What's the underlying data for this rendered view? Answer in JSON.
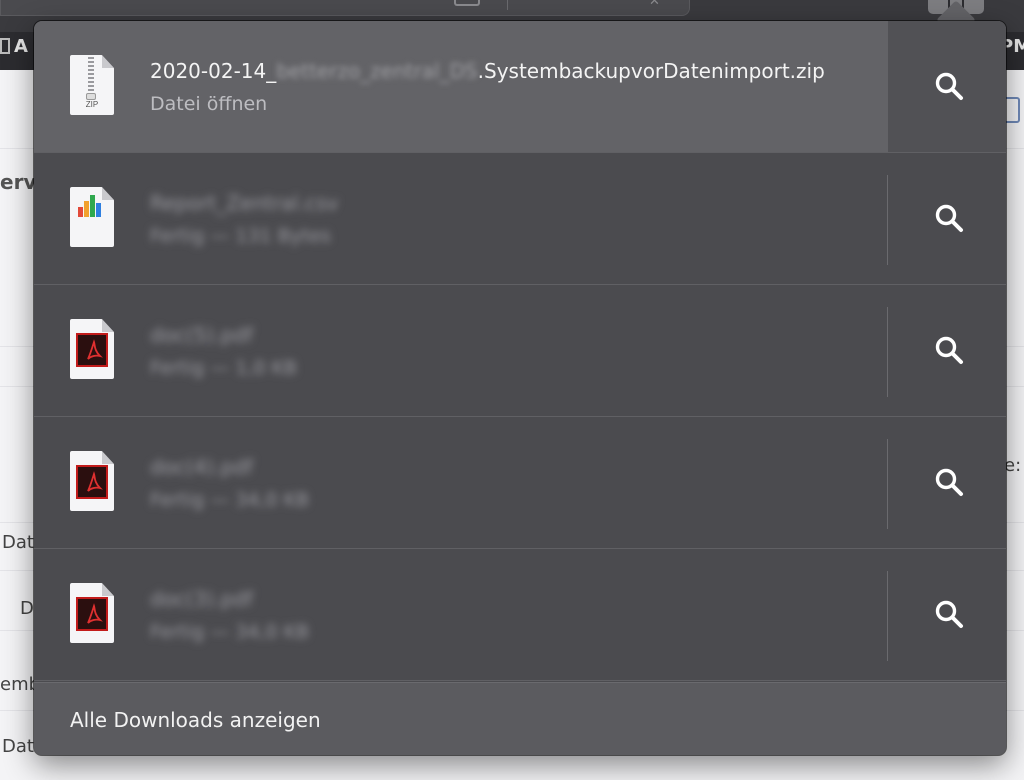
{
  "background": {
    "bookmark_left": "A",
    "bookmark_right": "PM",
    "side_texts": [
      "erv",
      "Dat",
      "D",
      "emb",
      "Dat",
      "e:"
    ]
  },
  "downloads": [
    {
      "type": "zip",
      "icon": "zip-file-icon",
      "name_prefix": "2020-02-14_",
      "name_hidden": "betterzo_zentral_DS",
      "name_suffix": ".SystembackupvorDatenimport.zip",
      "subtitle": "Datei öffnen",
      "selected": true
    },
    {
      "type": "numbers",
      "icon": "numbers-file-icon",
      "name": "Report_Zentral.csv",
      "subtitle": "Fertig — 131 Bytes",
      "selected": false
    },
    {
      "type": "pdf",
      "icon": "pdf-file-icon",
      "name": "doc(5).pdf",
      "subtitle": "Fertig — 1,0 KB",
      "selected": false
    },
    {
      "type": "pdf",
      "icon": "pdf-file-icon",
      "name": "doc(4).pdf",
      "subtitle": "Fertig — 34,0 KB",
      "selected": false
    },
    {
      "type": "pdf",
      "icon": "pdf-file-icon",
      "name": "doc(3).pdf",
      "subtitle": "Fertig — 34,0 KB",
      "selected": false
    }
  ],
  "footer": {
    "show_all_label": "Alle Downloads anzeigen"
  },
  "colors": {
    "popover_bg": "#4b4b4f",
    "selected_row": "#636367",
    "pdf_red": "#c21b1b"
  }
}
